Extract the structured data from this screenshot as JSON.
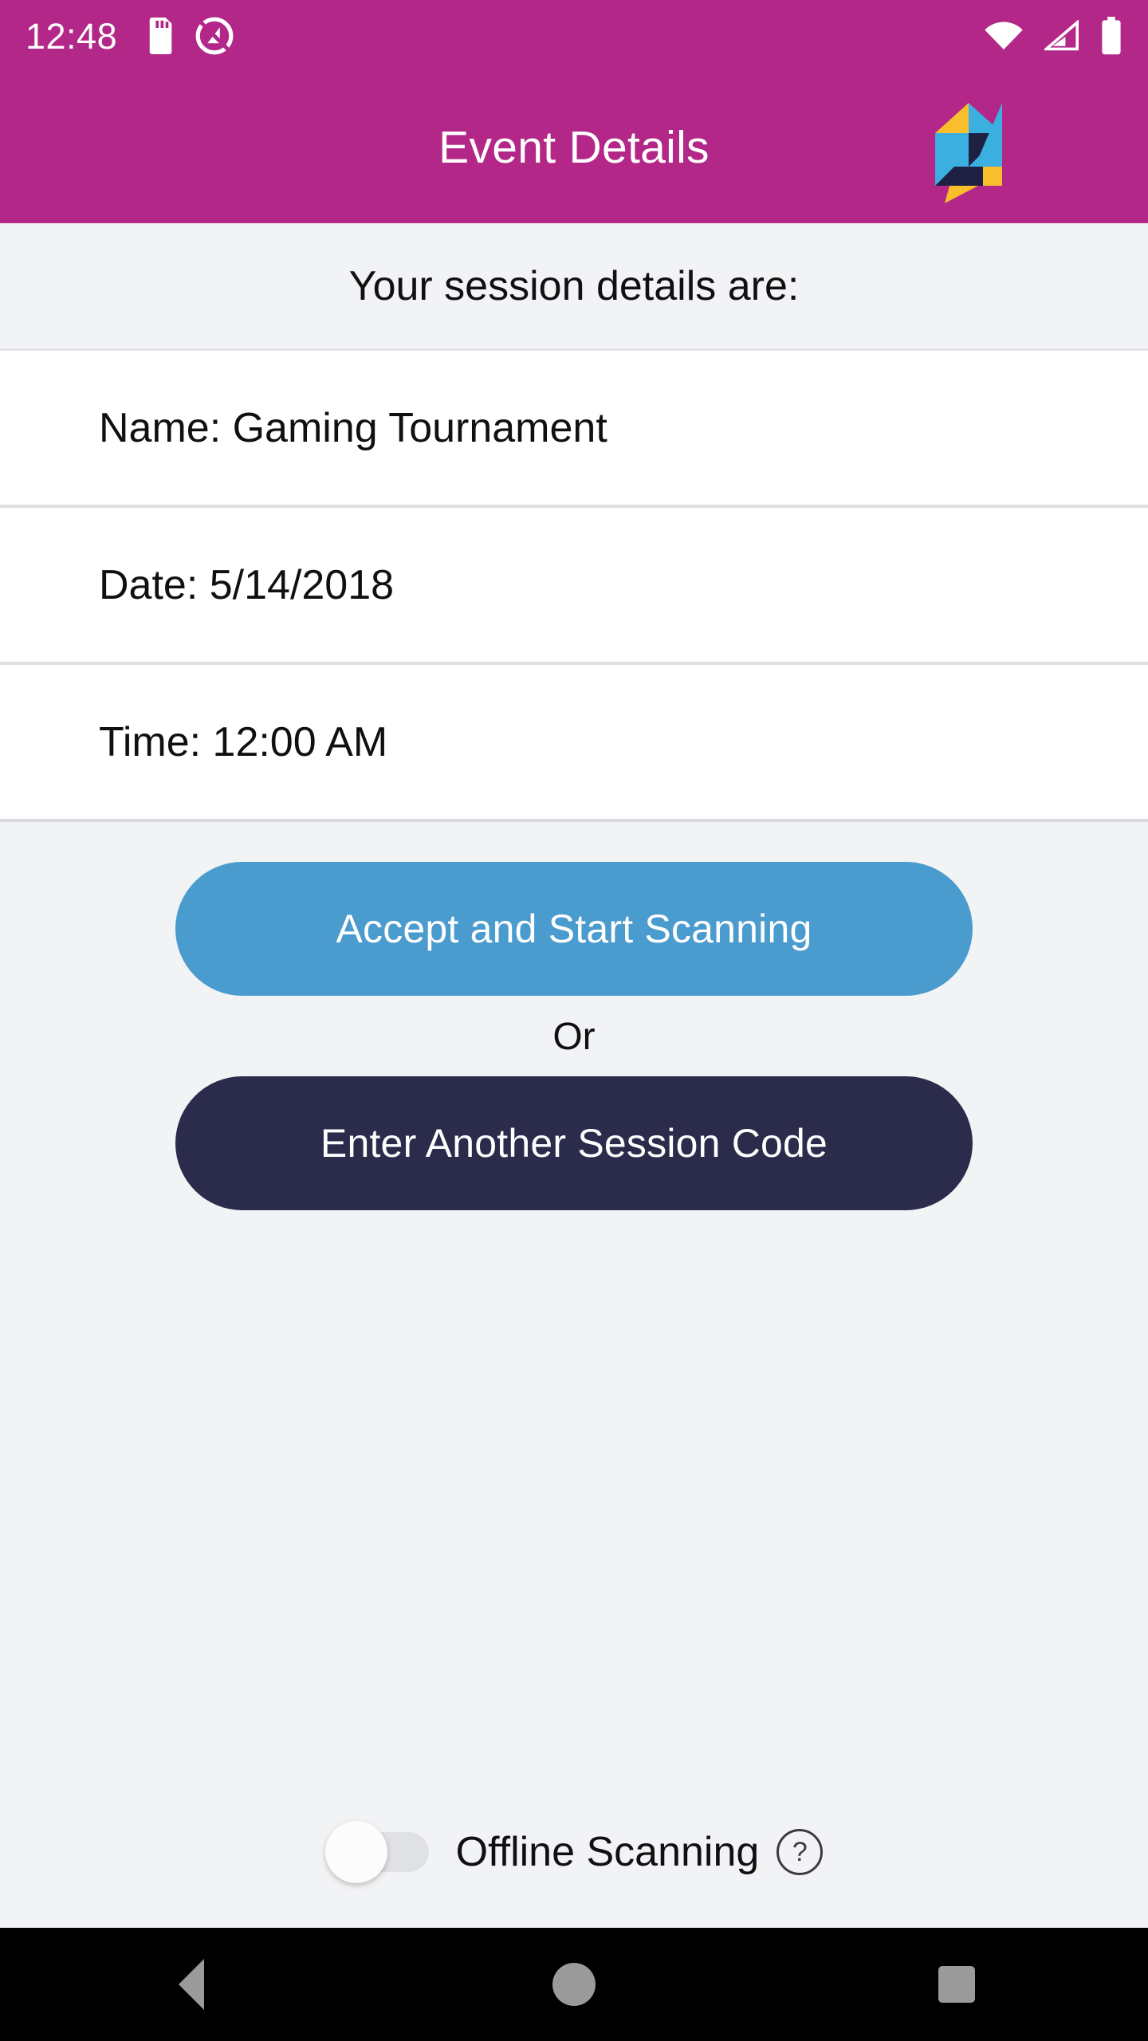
{
  "status_bar": {
    "clock": "12:48",
    "left_icons": [
      "sd-card-icon",
      "do-not-disturb-icon"
    ],
    "right_icons": [
      "wifi-icon",
      "cellular-signal-icon",
      "battery-full-icon"
    ],
    "background_color": "#B22787",
    "foreground_color": "#FFFFFF"
  },
  "app_bar": {
    "title": "Event Details",
    "logo_name": "app-logo-icon",
    "background_color": "#B22787",
    "title_color": "#FFFFFF",
    "logo_colors": {
      "yellow": "#F9BE2C",
      "cyan": "#3AAFE0",
      "navy": "#1E2142"
    }
  },
  "content": {
    "subheader": "Your session details are:",
    "details": [
      {
        "text": "Name: Gaming Tournament",
        "field": "Name",
        "value": "Gaming Tournament"
      },
      {
        "text": "Date: 5/14/2018",
        "field": "Date",
        "value": "5/14/2018"
      },
      {
        "text": "Time: 12:00 AM",
        "field": "Time",
        "value": "12:00 AM"
      }
    ]
  },
  "actions": {
    "primary_button": "Accept and Start Scanning",
    "primary_color": "#4A9BCE",
    "divider_text": "Or",
    "secondary_button": "Enter Another Session Code",
    "secondary_color": "#2B2B4B"
  },
  "offline": {
    "label": "Offline Scanning",
    "toggle_state": "off",
    "help_icon_glyph": "?",
    "help_icon_name": "help-circle-icon"
  },
  "nav_bar": {
    "back": "back-triangle-icon",
    "home": "home-circle-icon",
    "recents": "recents-square-icon",
    "background_color": "#000000",
    "icon_color": "#9A9A9A"
  }
}
